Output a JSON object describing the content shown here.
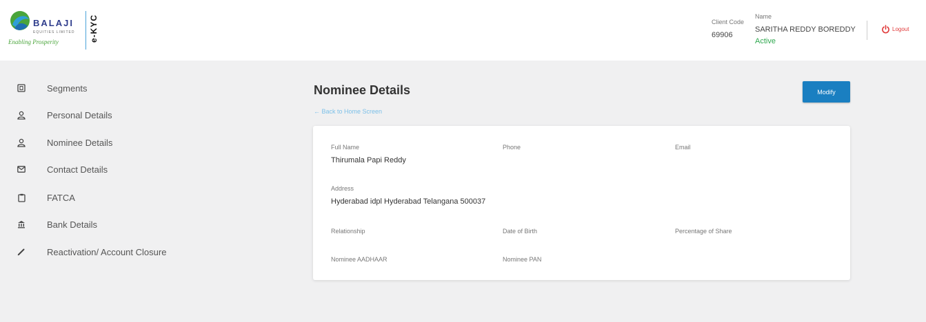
{
  "brand": {
    "name": "BALAJI",
    "subtitle": "EQUITIES LIMITED",
    "tagline": "Enabling Prosperity",
    "product": "e-KYC",
    "colors": {
      "primary": "#2f3d8c",
      "accent": "#4aa3d9",
      "green": "#4aa53b"
    }
  },
  "header": {
    "client_code_label": "Client Code",
    "client_code": "69906",
    "name_label": "Name",
    "name": "SARITHA REDDY BOREDDY",
    "status": "Active",
    "logout_label": "Logout",
    "logout_icon": "power-icon"
  },
  "sidebar": {
    "items": [
      {
        "label": "Segments",
        "icon": "segments-icon"
      },
      {
        "label": "Personal Details",
        "icon": "person-icon"
      },
      {
        "label": "Nominee Details",
        "icon": "person-icon"
      },
      {
        "label": "Contact Details",
        "icon": "mail-icon"
      },
      {
        "label": "FATCA",
        "icon": "clipboard-icon"
      },
      {
        "label": "Bank Details",
        "icon": "bank-icon"
      },
      {
        "label": "Reactivation/ Account Closure",
        "icon": "pencil-icon"
      }
    ]
  },
  "main": {
    "title": "Nominee Details",
    "back_link": "← Back to Home Screen",
    "modify_label": "Modify",
    "fields": {
      "full_name_label": "Full Name",
      "full_name": "Thirumala Papi Reddy",
      "phone_label": "Phone",
      "phone": "",
      "email_label": "Email",
      "email": "",
      "address_label": "Address",
      "address": "Hyderabad idpl Hyderabad Telangana 500037",
      "relationship_label": "Relationship",
      "relationship": "",
      "dob_label": "Date of Birth",
      "dob": "",
      "share_label": "Percentage of Share",
      "share": "",
      "aadhaar_label": "Nominee AADHAAR",
      "aadhaar": "",
      "pan_label": "Nominee PAN",
      "pan": ""
    }
  },
  "colors": {
    "button": "#1a7fc1",
    "link": "#7cc0e8",
    "status_active": "#2fa84f",
    "logout": "#e03a3a",
    "background": "#f0f0f1"
  }
}
